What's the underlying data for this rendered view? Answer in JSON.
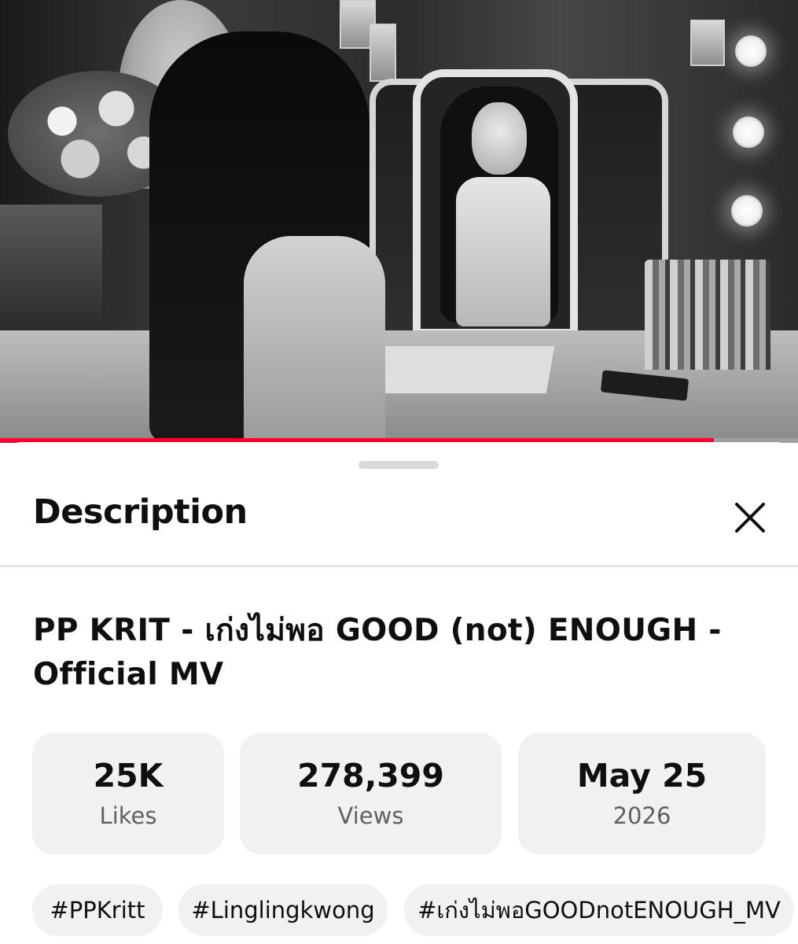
{
  "video": {
    "progress_fraction": 0.895,
    "progress_color": "#ff0033"
  },
  "sheet": {
    "heading": "Description",
    "close_icon": "close-icon",
    "video_title": "PP KRIT - เก่งไม่พอ GOOD (not) ENOUGH - Official MV",
    "stats": [
      {
        "value": "25K",
        "label": "Likes"
      },
      {
        "value": "278,399",
        "label": "Views"
      },
      {
        "value": "May 25",
        "label": "2026"
      }
    ],
    "hashtags": [
      "#PPKritt",
      "#Linglingkwong",
      "#เก่งไม่พอGOODnotENOUGH_MV"
    ]
  }
}
